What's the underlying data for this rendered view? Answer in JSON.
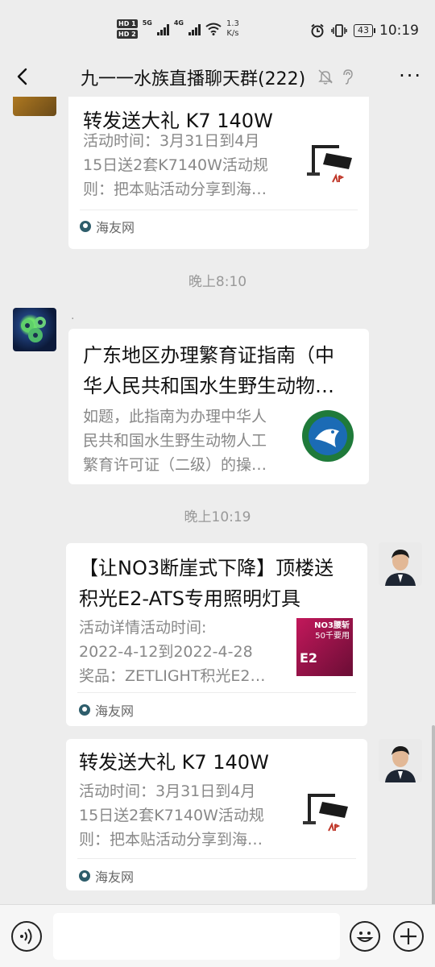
{
  "status_bar": {
    "hd1": "HD 1",
    "hd2": "HD 2",
    "net1": "5G",
    "net2": "4G",
    "speed_value": "1.3",
    "speed_unit": "K/s",
    "battery": "43",
    "time": "10:19"
  },
  "header": {
    "title": "九一一水族直播聊天群(222)",
    "more": "···"
  },
  "messages": [
    {
      "title": "转发送大礼 K7 140W",
      "desc": [
        "活动时间：3月31日到4月",
        "15日送2套K7140W活动规",
        "则：把本贴活动分享到海…"
      ],
      "source": "海友网"
    },
    {
      "timestamp": "晚上8:10",
      "sender_name": ".",
      "title": [
        "广东地区办理繁育证指南（中",
        "华人民共和国水生野生动物…"
      ],
      "desc": [
        "如题，此指南为办理中华人",
        "民共和国水生野生动物人工",
        "繁育许可证（二级）的操…"
      ]
    },
    {
      "timestamp": "晚上10:19",
      "title": [
        "【让NO3断崖式下降】顶楼送",
        "积光E2-ATS专用照明灯具"
      ],
      "desc": [
        "活动详情活动时间:",
        "2022-4-12到2022-4-28",
        "奖品：ZETLIGHT积光E2…"
      ],
      "thumb_text": [
        "NO3腰斩",
        "50千要用",
        "E2"
      ],
      "source": "海友网"
    },
    {
      "title": "转发送大礼 K7 140W",
      "desc": [
        "活动时间：3月31日到4月",
        "15日送2套K7140W活动规",
        "则：把本贴活动分享到海…"
      ],
      "source": "海友网"
    }
  ],
  "colors": {
    "background": "#ededed",
    "card": "#ffffff",
    "secondary_text": "#888888"
  }
}
